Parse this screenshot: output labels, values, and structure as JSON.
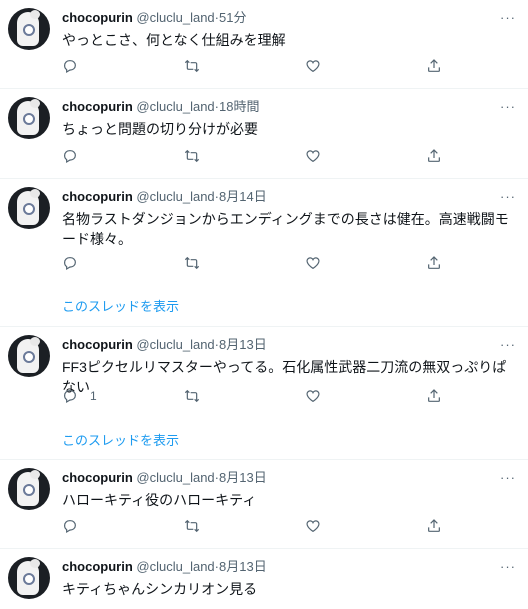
{
  "tweets": [
    {
      "name": "chocopurin",
      "handle": "@cluclu_land",
      "sep": "·",
      "time": "51分",
      "text": "やっとこさ、何となく仕組みを理解",
      "reply_count": "",
      "thread_link": ""
    },
    {
      "name": "chocopurin",
      "handle": "@cluclu_land",
      "sep": "·",
      "time": "18時間",
      "text": "ちょっと問題の切り分けが必要",
      "reply_count": "",
      "thread_link": ""
    },
    {
      "name": "chocopurin",
      "handle": "@cluclu_land",
      "sep": "·",
      "time": "8月14日",
      "text": "名物ラストダンジョンからエンディングまでの長さは健在。高速戦闘モード様々。",
      "reply_count": "",
      "thread_link": "このスレッドを表示"
    },
    {
      "name": "chocopurin",
      "handle": "@cluclu_land",
      "sep": "·",
      "time": "8月13日",
      "text": "FF3ピクセルリマスターやってる。石化属性武器二刀流の無双っぷりぱない",
      "reply_count": "1",
      "thread_link": "このスレッドを表示"
    },
    {
      "name": "chocopurin",
      "handle": "@cluclu_land",
      "sep": "·",
      "time": "8月13日",
      "text": "ハローキティ役のハローキティ",
      "reply_count": "",
      "thread_link": ""
    },
    {
      "name": "chocopurin",
      "handle": "@cluclu_land",
      "sep": "·",
      "time": "8月13日",
      "text": "キティちゃんシンカリオン見る",
      "reply_count": "",
      "thread_link": ""
    }
  ],
  "icons": {
    "more": "more-horizontal-icon",
    "reply": "reply-icon",
    "retweet": "retweet-icon",
    "like": "heart-icon",
    "share": "share-icon"
  },
  "colors": {
    "link": "#1d9bf0",
    "secondary_text": "#536471",
    "divider": "#eff3f4"
  }
}
